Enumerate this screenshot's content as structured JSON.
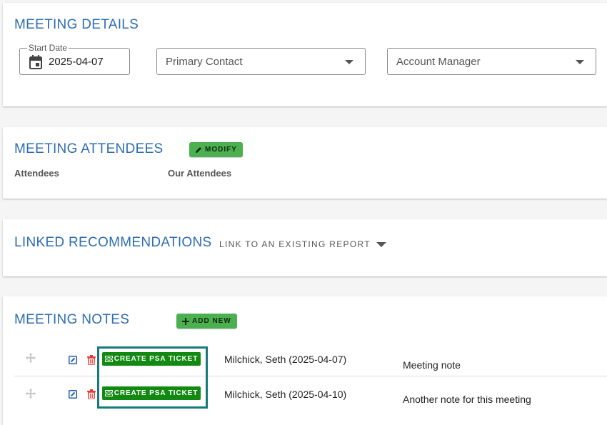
{
  "meeting_details": {
    "title": "MEETING DETAILS",
    "start_date_label": "Start Date",
    "start_date_value": "2025-04-07",
    "primary_contact_placeholder": "Primary Contact",
    "account_manager_placeholder": "Account Manager"
  },
  "attendees": {
    "title": "MEETING ATTENDEES",
    "modify_label": "MODIFY",
    "attendees_label": "Attendees",
    "our_attendees_label": "Our Attendees"
  },
  "linked": {
    "title": "LINKED RECOMMENDATIONS",
    "link_existing_label": "LINK TO AN EXISTING REPORT"
  },
  "notes": {
    "title": "MEETING NOTES",
    "add_new_label": "ADD NEW",
    "rows": [
      {
        "psa_label": "CREATE PSA TICKET",
        "author": "Milchick, Seth (2025-04-07)",
        "text": "Meeting note"
      },
      {
        "psa_label": "CREATE PSA TICKET",
        "author": "Milchick, Seth (2025-04-10)",
        "text": "Another note for this meeting"
      }
    ]
  },
  "colors": {
    "title_blue": "#2e6db4",
    "button_green": "#4caf50",
    "psa_green": "#128a12",
    "highlight": "#157a78",
    "delete_red": "#e53935"
  }
}
